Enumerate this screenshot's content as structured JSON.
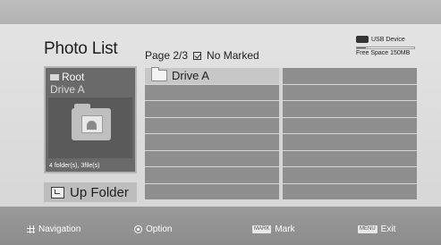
{
  "header": {
    "title": "Photo List",
    "page": "Page 2/3",
    "marked": "No Marked"
  },
  "device": {
    "name": "USB Device",
    "free_space": "Free Space 150MB",
    "used_fraction": 0.15
  },
  "left_panel": {
    "root_label": "Root",
    "drive_label": "Drive A",
    "count_label": "4 folder(s), 3file(s)",
    "up_folder_label": "Up Folder"
  },
  "list": {
    "items": [
      {
        "label": "Drive A",
        "icon": "folder-icon",
        "selected": true
      }
    ],
    "empty_rows": 15
  },
  "footer": {
    "navigation_label": "Navigation",
    "option_label": "Option",
    "mark_key": "MARK",
    "mark_label": "Mark",
    "exit_key": "MENU",
    "exit_label": "Exit"
  }
}
